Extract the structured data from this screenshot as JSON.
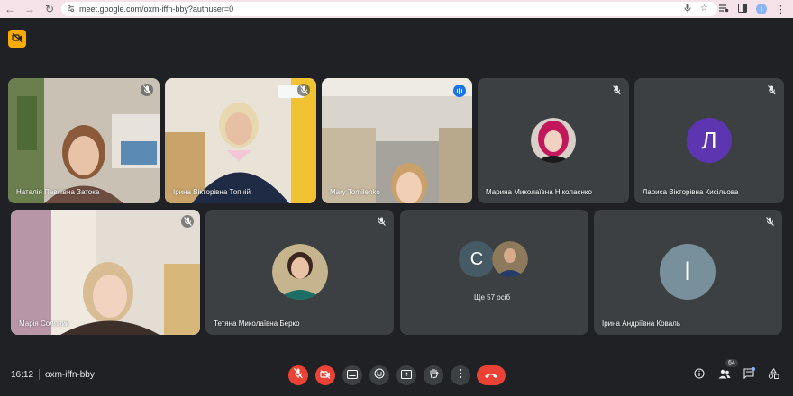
{
  "browser": {
    "url": "meet.google.com/oxm-iffn-bby?authuser=0",
    "profile_initial": "I"
  },
  "tiles": [
    {
      "name": "Наталія Павлівна Затока",
      "type": "video",
      "mic_muted": true
    },
    {
      "name": "Ірина Вікторівна Топчій",
      "type": "video",
      "mic_muted": true
    },
    {
      "name": "Mary Tomilenko",
      "type": "video",
      "speaking": true
    },
    {
      "name": "Марина Миколаївна Ніколаєнко",
      "type": "avatar-photo",
      "mic_muted": true
    },
    {
      "name": "Лариса Вікторівна Кисільова",
      "type": "avatar-letter",
      "initial": "Л",
      "avatar_color": "#5e35b1",
      "mic_muted": true
    },
    {
      "name": "Марія Соляник",
      "type": "video",
      "mic_muted": true
    },
    {
      "name": "Тетяна Миколаївна Берко",
      "type": "avatar-photo",
      "mic_muted": true
    },
    {
      "name": "Ще 57 осіб",
      "type": "others",
      "initial": "С",
      "avatar_color": "#455a64"
    },
    {
      "name": "Ірина Андріївна Коваль",
      "type": "avatar-letter",
      "initial": "І",
      "avatar_color": "#78909c",
      "mic_muted": true
    }
  ],
  "bottom_bar": {
    "time": "16:12",
    "meeting_code": "oxm-iffn-bby",
    "participants_count": "64"
  },
  "colors": {
    "background": "#202124",
    "tile": "#3c4043",
    "danger": "#ea4335",
    "accent": "#8ab4f8",
    "badge": "#f9ab00"
  },
  "icons": [
    "back-icon",
    "forward-icon",
    "reload-icon",
    "site-info-icon",
    "mic-icon",
    "star-icon",
    "media-icon",
    "sidepanel-icon",
    "menu-icon",
    "camera-off-icon",
    "mic-off-icon",
    "captions-icon",
    "emoji-icon",
    "present-icon",
    "hand-icon",
    "more-vert-icon",
    "call-end-icon",
    "info-icon",
    "people-icon",
    "chat-icon",
    "activities-icon"
  ]
}
